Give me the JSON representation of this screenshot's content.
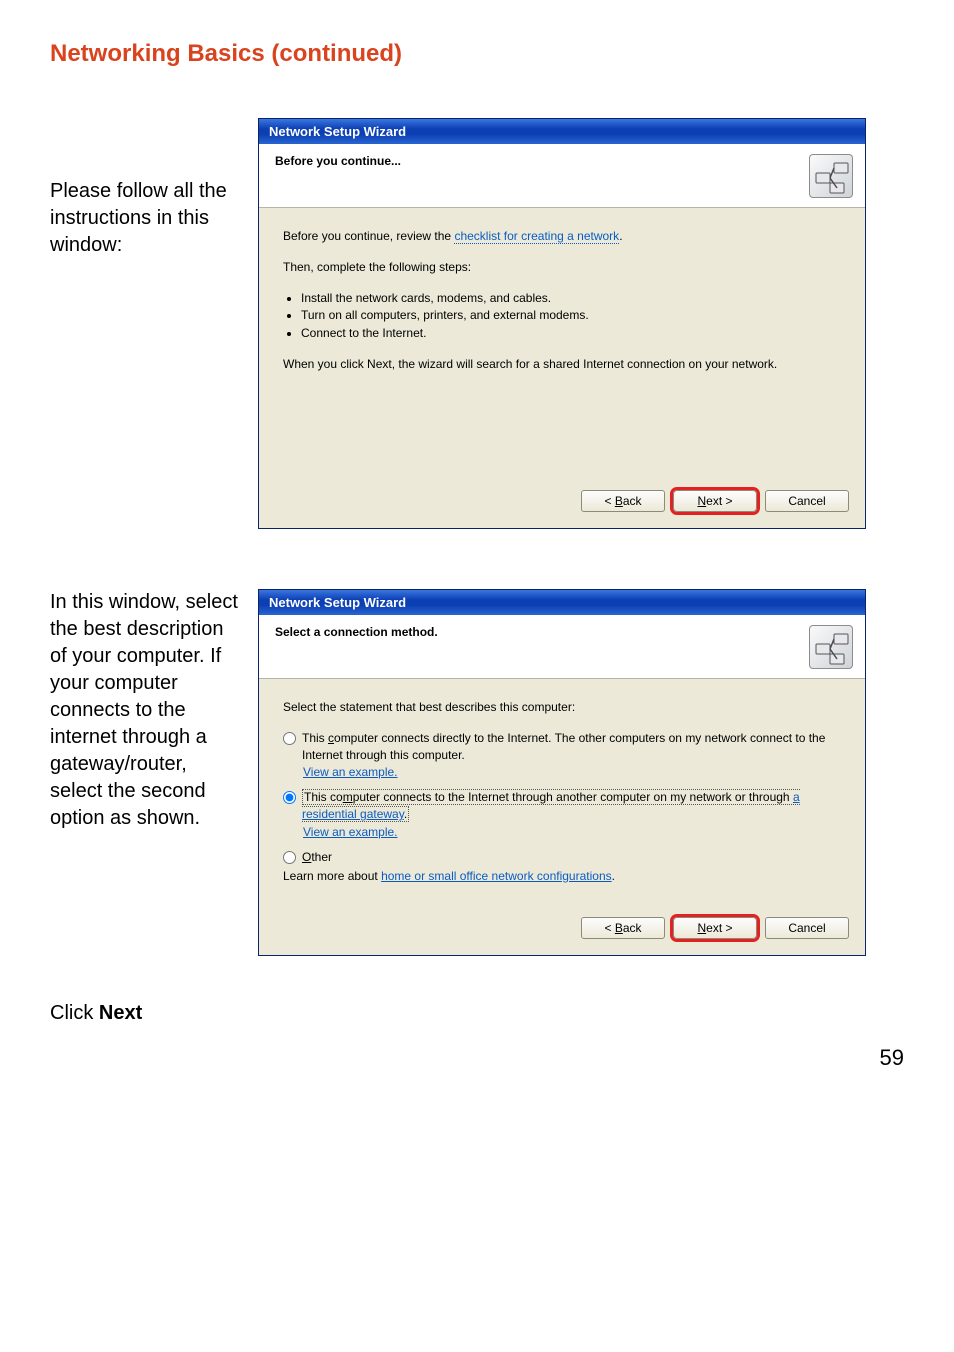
{
  "heading": "Networking Basics (continued)",
  "pageNumber": "59",
  "section1": {
    "sideText": "Please follow all the instructions in this window:",
    "title": "Network Setup Wizard",
    "header": "Before you continue...",
    "introBefore": "Before you continue, review the ",
    "checklistLink": "checklist for creating a network",
    "introAfter": ".",
    "thenLine": "Then, complete the following steps:",
    "bullets": [
      "Install the network cards, modems, and cables.",
      "Turn on all computers, printers, and external modems.",
      "Connect to the Internet."
    ],
    "afterBullets": "When you click Next, the wizard will search for a shared Internet connection on your network.",
    "back": "< Back",
    "next": "Next >",
    "cancel": "Cancel"
  },
  "section2": {
    "sideText": "In this window, select the best description of your computer. If your computer connects to the internet through a gateway/router, select the second option as shown.",
    "clickNextPrefix": "Click ",
    "clickNextBold": "Next",
    "title": "Network Setup Wizard",
    "header": "Select a connection method.",
    "prompt": "Select the statement that best describes this computer:",
    "opt1": "This computer connects directly to the Internet. The other computers on my network connect to the Internet through this computer.",
    "opt2a": "This computer connects to the Internet through another computer on my network or through ",
    "opt2b": "a residential gateway",
    "opt2c": ".",
    "opt3": "Other",
    "viewExample": "View an example.",
    "learnBefore": "Learn more about ",
    "learnLink": "home or small office network configurations",
    "learnAfter": ".",
    "back": "< Back",
    "next": "Next >",
    "cancel": "Cancel"
  }
}
